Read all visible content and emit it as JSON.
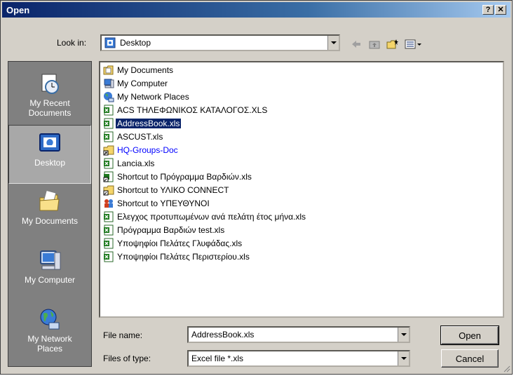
{
  "window": {
    "title": "Open",
    "help_label": "?",
    "close_label": "✕"
  },
  "toolbar": {
    "look_in_label": "Look in:",
    "look_in_value": "Desktop",
    "back_icon": "back-arrow-icon",
    "up_icon": "up-folder-icon",
    "new_folder_icon": "new-folder-icon",
    "views_icon": "views-menu-icon"
  },
  "places": [
    {
      "label": "My Recent Documents",
      "icon": "recent-documents-icon"
    },
    {
      "label": "Desktop",
      "icon": "desktop-icon"
    },
    {
      "label": "My Documents",
      "icon": "my-documents-icon"
    },
    {
      "label": "My Computer",
      "icon": "my-computer-icon"
    },
    {
      "label": "My Network Places",
      "icon": "network-places-icon"
    }
  ],
  "files": [
    {
      "name": "My Documents",
      "icon": "my-documents-icon"
    },
    {
      "name": "My Computer",
      "icon": "my-computer-icon"
    },
    {
      "name": "My Network Places",
      "icon": "network-places-icon"
    },
    {
      "name": "ACS ΤΗΛΕΦΩΝΙΚΟΣ ΚΑΤΑΛΟΓΟΣ.XLS",
      "icon": "excel-file-icon"
    },
    {
      "name": "AddressBook.xls",
      "icon": "excel-file-icon"
    },
    {
      "name": "ASCUST.xls",
      "icon": "excel-file-icon"
    },
    {
      "name": "HQ-Groups-Doc",
      "icon": "folder-shortcut-icon"
    },
    {
      "name": "Lancia.xls",
      "icon": "excel-file-icon"
    },
    {
      "name": "Shortcut to Πρόγραμμα Βαρδιών.xls",
      "icon": "excel-shortcut-icon"
    },
    {
      "name": "Shortcut to ΥΛΙΚΟ CONNECT",
      "icon": "folder-shortcut-icon"
    },
    {
      "name": "Shortcut to ΥΠΕΥΘΥΝΟΙ",
      "icon": "users-shortcut-icon"
    },
    {
      "name": "Ελεγχος προτυπωμένων ανά πελάτη έτος μήνα.xls",
      "icon": "excel-file-icon"
    },
    {
      "name": "Πρόγραμμα Βαρδιών test.xls",
      "icon": "excel-file-icon"
    },
    {
      "name": "Υποψηφίοι Πελάτες Γλυφάδας.xls",
      "icon": "excel-file-icon"
    },
    {
      "name": "Υποψηφίοι Πελάτες Περιστερίου.xls",
      "icon": "excel-file-icon"
    }
  ],
  "selected_file": "AddressBook.xls",
  "file_name": {
    "label": "File name:",
    "value": "AddressBook.xls"
  },
  "file_type": {
    "label": "Files of type:",
    "value": "Excel file *.xls"
  },
  "buttons": {
    "open_label": "Open",
    "cancel_label": "Cancel"
  },
  "colors": {
    "title_bar": "#0a246a",
    "selection": "#0a246a",
    "places_bar": "#808080",
    "link_text": "#0000ff"
  }
}
